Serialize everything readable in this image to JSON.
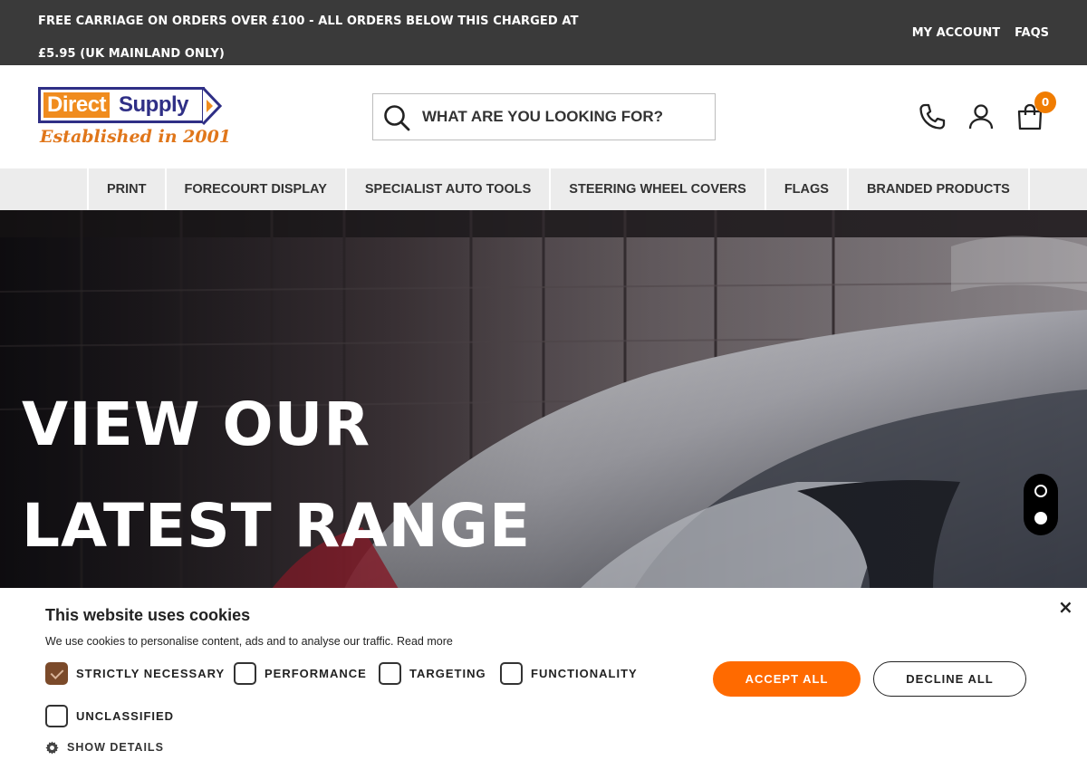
{
  "topbar": {
    "promo": "FREE CARRIAGE ON ORDERS OVER £100 - ALL ORDERS BELOW THIS CHARGED AT £5.95 (UK MAINLAND ONLY)",
    "links": [
      "MY ACCOUNT",
      "FAQS"
    ]
  },
  "header": {
    "logo_left": "Direct",
    "logo_right": "Supply",
    "logo_tagline": "Established in 2001",
    "search_placeholder": "WHAT ARE YOU LOOKING FOR?",
    "cart_count": "0",
    "icons": [
      "phone-icon",
      "user-icon",
      "cart-icon",
      "search-icon"
    ]
  },
  "nav": {
    "items": [
      "PRINT",
      "FORECOURT DISPLAY",
      "SPECIALIST AUTO TOOLS",
      "STEERING WHEEL COVERS",
      "FLAGS",
      "BRANDED PRODUCTS"
    ]
  },
  "hero": {
    "line1": "VIEW OUR",
    "line2": "LATEST RANGE",
    "slides_total": 2,
    "active_slide": 2
  },
  "cookie": {
    "title": "This website uses cookies",
    "description": "We use cookies to personalise content, ads and to analyse our traffic.",
    "read_more": "Read more",
    "close_label": "×",
    "options": [
      {
        "label": "STRICTLY NECESSARY",
        "checked": true
      },
      {
        "label": "PERFORMANCE",
        "checked": false
      },
      {
        "label": "TARGETING",
        "checked": false
      },
      {
        "label": "FUNCTIONALITY",
        "checked": false
      },
      {
        "label": "UNCLASSIFIED",
        "checked": false
      }
    ],
    "accept_label": "ACCEPT ALL",
    "decline_label": "DECLINE ALL",
    "details_label": "SHOW DETAILS"
  },
  "colors": {
    "topbar_bg": "#3a3a3a",
    "accent_orange": "#ff6a00",
    "logo_blue": "#2f2f86",
    "nav_bg": "#ececec",
    "cookie_bg": "#ffffff"
  }
}
